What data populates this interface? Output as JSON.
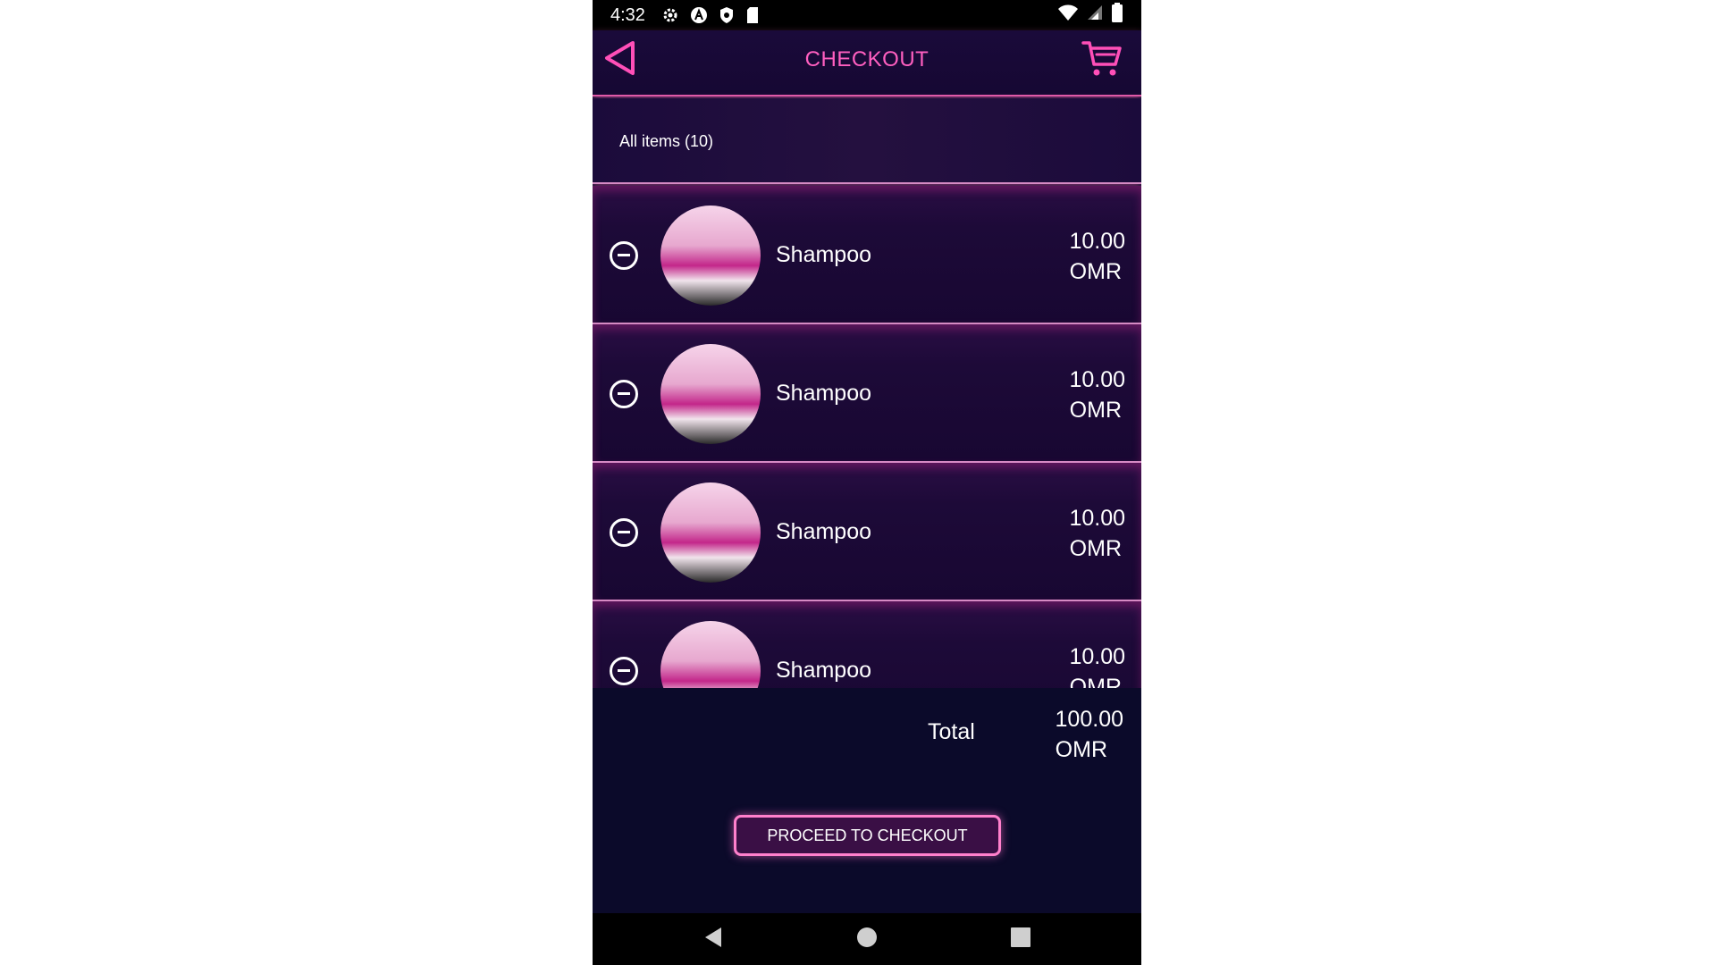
{
  "status_bar": {
    "time": "4:32",
    "icons": [
      "gear-icon",
      "a-circle-icon",
      "shield-icon",
      "sd-card-icon"
    ],
    "right_icons": [
      "wifi-icon",
      "signal-icon",
      "battery-icon"
    ]
  },
  "header": {
    "title": "CHECKOUT",
    "back_icon": "back-triangle-icon",
    "cart_icon": "cart-icon",
    "accent_color": "#ff5fc0"
  },
  "items_header": {
    "label": "All items (10)"
  },
  "cart_items": [
    {
      "name": "Shampoo",
      "amount": "10.00",
      "currency": "OMR"
    },
    {
      "name": "Shampoo",
      "amount": "10.00",
      "currency": "OMR"
    },
    {
      "name": "Shampoo",
      "amount": "10.00",
      "currency": "OMR"
    },
    {
      "name": "Shampoo",
      "amount": "10.00",
      "currency": "OMR"
    }
  ],
  "summary": {
    "total_label": "Total",
    "total_amount": "100.00",
    "total_currency": "OMR"
  },
  "checkout_button": {
    "label": "PROCEED TO CHECKOUT"
  },
  "nav_bar": {
    "icons": [
      "nav-back-icon",
      "nav-home-icon",
      "nav-recents-icon"
    ]
  }
}
